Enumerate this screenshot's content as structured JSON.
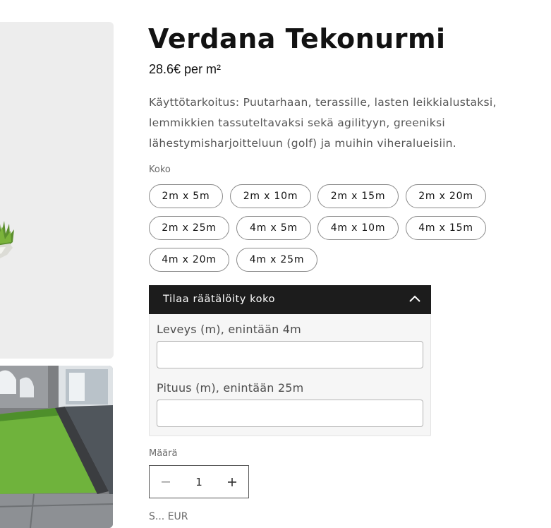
{
  "product": {
    "title": "Verdana Tekonurmi",
    "price": "28.6€ per m²",
    "description": "Käyttötarkoitus: Puutarhaan, terassille, lasten leikkialustaksi, lemmikkien tassuteltavaksi sekä agilityyn, greeniksi lähestymisharjoitteluun (golf) ja muihin viheralueisiin."
  },
  "size": {
    "label": "Koko",
    "options": [
      "2m x 5m",
      "2m x 10m",
      "2m x 15m",
      "2m x 20m",
      "2m x 25m",
      "4m x 5m",
      "4m x 10m",
      "4m x 15m",
      "4m x 20m",
      "4m x 25m"
    ]
  },
  "custom_size": {
    "header": "Tilaa räätälöity koko",
    "width_label": "Leveys (m), enintään 4m",
    "width_value": "",
    "length_label": "Pituus (m), enintään 25m",
    "length_value": ""
  },
  "quantity": {
    "label": "Määrä",
    "value": "1"
  },
  "partial_label": "S... EUR",
  "icons": {
    "chevron": "chevron-up-icon",
    "minus": "minus-icon",
    "plus": "plus-icon"
  }
}
